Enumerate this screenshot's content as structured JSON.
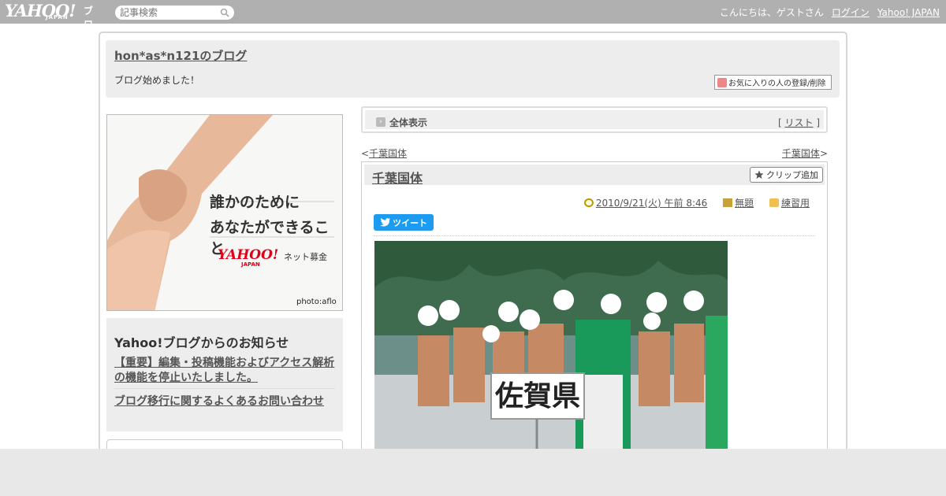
{
  "topbar": {
    "logo_main": "YAHOO!",
    "logo_sub": "JAPAN",
    "logo_blog": "ブログ",
    "search_placeholder": "記事検索",
    "greeting": "こんにちは、ゲストさん",
    "login": "ログイン",
    "yahoo_japan": "Yahoo! JAPAN"
  },
  "header": {
    "title": "hon*as*n121のブログ",
    "description": "ブログ始めました！",
    "favorite_button": "お気に入りの人の登録/削除"
  },
  "sidebar": {
    "banner": {
      "line1": "誰かのために",
      "line2": "あなたができること",
      "yahoo": "YAHOO!",
      "yahoo_sub": "JAPAN",
      "net": "ネット募金",
      "photo_credit": "photo:aflo"
    },
    "notice": {
      "title": "Yahoo!ブログからのお知らせ",
      "items": [
        "【重要】編集・投稿機能およびアクセス解析の機能を停止いたしました。",
        "ブログ移行に関するよくあるお問い合わせ"
      ]
    }
  },
  "main": {
    "allview_label": "全体表示",
    "list_link": "リスト",
    "prev_link": "千葉国体",
    "next_link": "千葉国体",
    "article": {
      "title": "千葉国体",
      "clip_button": "クリップ追加",
      "date": "2010/9/21(火) 午前 8:46",
      "theme": "無題",
      "category": "練習用",
      "tweet": "ツイート",
      "photo_sign": "佐賀県"
    }
  }
}
